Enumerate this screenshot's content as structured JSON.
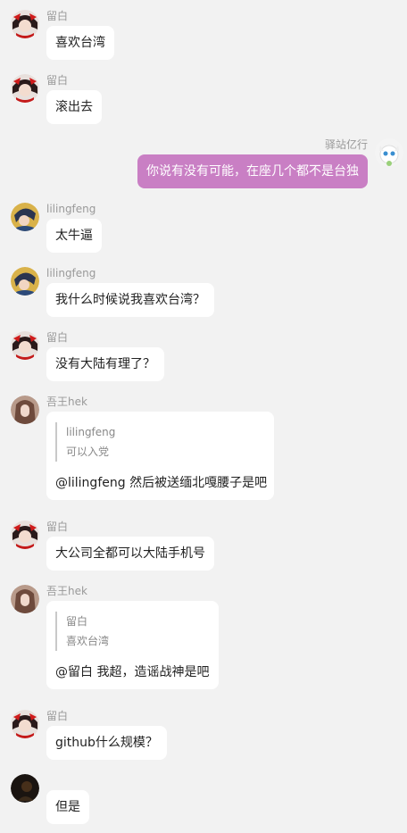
{
  "messages": [
    {
      "sender": "留白",
      "text": "喜欢台湾",
      "avatar": "touhou-girl-avatar"
    },
    {
      "sender": "留白",
      "text": "滚出去",
      "avatar": "touhou-girl-avatar"
    },
    {
      "sender": "驿站亿行",
      "text": "你说有没有可能，在座几个都不是台独",
      "avatar": "white-cat-avatar",
      "self": true
    },
    {
      "sender": "lilingfeng",
      "text": "太牛逼",
      "avatar": "anime-boy-avatar"
    },
    {
      "sender": "lilingfeng",
      "text": "我什么时候说我喜欢台湾？",
      "avatar": "anime-boy-avatar"
    },
    {
      "sender": "留白",
      "text": "没有大陆有理了？",
      "avatar": "touhou-girl-avatar"
    },
    {
      "sender": "吾王hek",
      "avatar": "long-hair-avatar",
      "quote": {
        "author": "lilingfeng",
        "text": "可以入党"
      },
      "text": "@lilingfeng 然后被送缅北嘎腰子是吧"
    },
    {
      "sender": "留白",
      "text": "大公司全都可以大陆手机号",
      "avatar": "touhou-girl-avatar"
    },
    {
      "sender": "吾王hek",
      "avatar": "long-hair-avatar",
      "quote": {
        "author": "留白",
        "text": "喜欢台湾"
      },
      "text": "@留白 我超，造谣战神是吧"
    },
    {
      "sender": "留白",
      "text": "github什么规模？",
      "avatar": "touhou-girl-avatar"
    },
    {
      "sender": "",
      "text": "但是",
      "avatar": "dark-avatar"
    }
  ],
  "colors": {
    "background": "#f2f2f2",
    "self_bubble": "#c97fc4",
    "other_bubble": "#ffffff"
  }
}
